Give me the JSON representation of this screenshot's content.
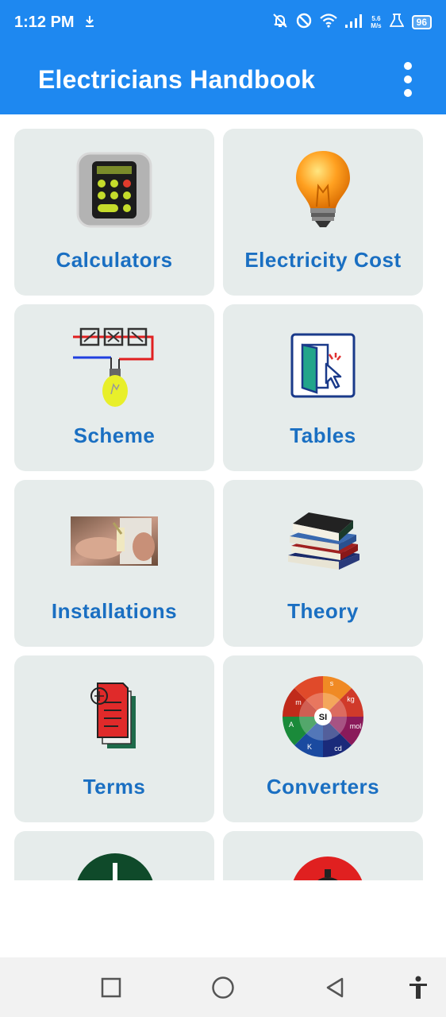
{
  "status_bar": {
    "time": "1:12 PM",
    "net_speed_top": "5.6",
    "net_speed_bottom": "M/s",
    "battery": "96",
    "icons": [
      "download-icon",
      "bell-off-icon",
      "do-not-disturb-icon",
      "wifi-icon",
      "signal-icon",
      "lab-icon",
      "battery-icon"
    ]
  },
  "app_bar": {
    "title": "Electricians Handbook",
    "menu_icon": "more-vert-icon"
  },
  "tiles": [
    {
      "label": "Calculators",
      "icon": "calculator-icon"
    },
    {
      "label": "Electricity Cost",
      "icon": "light-bulb-icon"
    },
    {
      "label": "Scheme",
      "icon": "circuit-scheme-icon"
    },
    {
      "label": "Tables",
      "icon": "door-cursor-icon"
    },
    {
      "label": "Installations",
      "icon": "installation-photo-icon"
    },
    {
      "label": "Theory",
      "icon": "books-icon"
    },
    {
      "label": "Terms",
      "icon": "documents-icon"
    },
    {
      "label": "Converters",
      "icon": "si-units-wheel-icon"
    },
    {
      "label": "",
      "icon": "green-circle-icon"
    },
    {
      "label": "",
      "icon": "red-timer-icon"
    }
  ],
  "si_wheel": [
    "s",
    "kg",
    "mol",
    "cd",
    "K",
    "A",
    "m",
    "SI"
  ],
  "nav_bar": {
    "icons": [
      "recents-square-icon",
      "home-circle-icon",
      "back-triangle-icon",
      "accessibility-icon"
    ]
  }
}
